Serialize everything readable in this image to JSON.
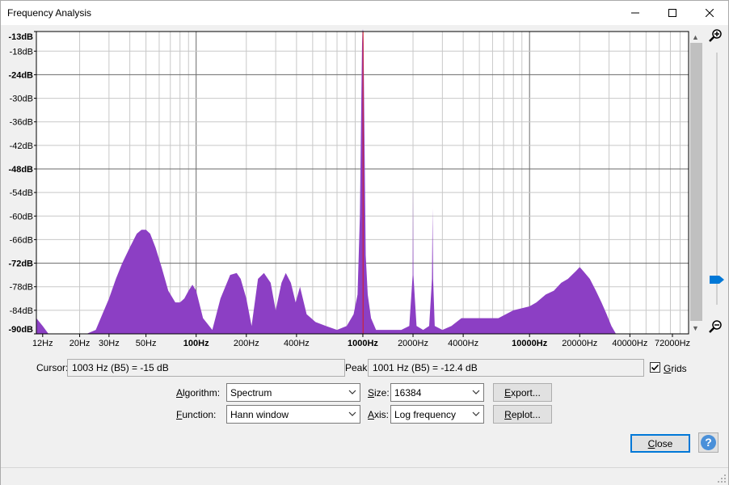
{
  "window": {
    "title": "Frequency Analysis",
    "minimize_icon": "minimize-icon",
    "maximize_icon": "maximize-icon",
    "close_icon": "close-icon"
  },
  "plot": {
    "y_labels": [
      {
        "text": "-13dB",
        "db": -13,
        "bold": true
      },
      {
        "text": "-18dB",
        "db": -18,
        "bold": false
      },
      {
        "text": "-24dB",
        "db": -24,
        "bold": true
      },
      {
        "text": "-30dB",
        "db": -30,
        "bold": false
      },
      {
        "text": "-36dB",
        "db": -36,
        "bold": false
      },
      {
        "text": "-42dB",
        "db": -42,
        "bold": false
      },
      {
        "text": "-48dB",
        "db": -48,
        "bold": true
      },
      {
        "text": "-54dB",
        "db": -54,
        "bold": false
      },
      {
        "text": "-60dB",
        "db": -60,
        "bold": false
      },
      {
        "text": "-66dB",
        "db": -66,
        "bold": false
      },
      {
        "text": "-72dB",
        "db": -72,
        "bold": true
      },
      {
        "text": "-78dB",
        "db": -78,
        "bold": false
      },
      {
        "text": "-84dB",
        "db": -84,
        "bold": false
      },
      {
        "text": "-90dB",
        "db": -90,
        "bold": true
      }
    ],
    "x_labels": [
      {
        "text": "12Hz",
        "hz": 12,
        "bold": false
      },
      {
        "text": "20Hz",
        "hz": 20,
        "bold": false
      },
      {
        "text": "30Hz",
        "hz": 30,
        "bold": false
      },
      {
        "text": "50Hz",
        "hz": 50,
        "bold": false
      },
      {
        "text": "100Hz",
        "hz": 100,
        "bold": true
      },
      {
        "text": "200Hz",
        "hz": 200,
        "bold": false
      },
      {
        "text": "400Hz",
        "hz": 400,
        "bold": false
      },
      {
        "text": "1000Hz",
        "hz": 1000,
        "bold": true
      },
      {
        "text": "2000Hz",
        "hz": 2000,
        "bold": false
      },
      {
        "text": "4000Hz",
        "hz": 4000,
        "bold": false
      },
      {
        "text": "10000Hz",
        "hz": 10000,
        "bold": true
      },
      {
        "text": "20000Hz",
        "hz": 20000,
        "bold": false
      },
      {
        "text": "40000Hz",
        "hz": 40000,
        "bold": false
      },
      {
        "text": "72000Hz",
        "hz": 72000,
        "bold": false
      }
    ],
    "cursor_hz": 1003,
    "zoom_in_icon": "zoom-in-icon",
    "zoom_out_icon": "zoom-out-icon",
    "zoom_level": 0.1
  },
  "chart_data": {
    "type": "area",
    "xscale": "log",
    "xlim": [
      11,
      90000
    ],
    "ylim": [
      -90,
      -13
    ],
    "grid": true,
    "color": "#8c3fc4",
    "cursor_color": "#d62020",
    "x": [
      11,
      12,
      13,
      15,
      18,
      20,
      22,
      25,
      28,
      30,
      33,
      36,
      40,
      44,
      47,
      50,
      53,
      57,
      62,
      68,
      75,
      80,
      85,
      90,
      95,
      100,
      110,
      125,
      140,
      160,
      175,
      185,
      200,
      215,
      235,
      255,
      280,
      300,
      325,
      345,
      370,
      395,
      420,
      460,
      520,
      600,
      700,
      800,
      880,
      930,
      960,
      980,
      990,
      995,
      1000,
      1005,
      1010,
      1020,
      1040,
      1070,
      1120,
      1200,
      1350,
      1500,
      1700,
      1900,
      1990,
      2000,
      2010,
      2100,
      2300,
      2500,
      2600,
      2620,
      2640,
      2700,
      3000,
      3400,
      3900,
      4500,
      5500,
      6500,
      8000,
      10000,
      11000,
      12500,
      14000,
      15500,
      17000,
      19000,
      20000,
      21000,
      23000,
      25000,
      27000,
      29000,
      31000,
      33000,
      90000
    ],
    "values": [
      -86,
      -88,
      -90,
      -90,
      -90,
      -90,
      -90,
      -89,
      -84,
      -81,
      -76,
      -72,
      -68,
      -64.5,
      -63.5,
      -63.5,
      -64.5,
      -68,
      -73,
      -79,
      -82,
      -82,
      -81,
      -79,
      -77.5,
      -79,
      -86,
      -89,
      -81,
      -75,
      -74.5,
      -76,
      -81,
      -88,
      -76,
      -74.5,
      -77,
      -84,
      -77,
      -74.5,
      -77,
      -82,
      -78,
      -85,
      -87,
      -88,
      -89,
      -88,
      -85,
      -80,
      -60,
      -30,
      -16,
      -13,
      -12.4,
      -13,
      -16,
      -35,
      -70,
      -80,
      -86,
      -89,
      -89,
      -89,
      -89,
      -88,
      -75,
      -53,
      -75,
      -88,
      -89,
      -88,
      -76,
      -58,
      -76,
      -88,
      -89,
      -88,
      -86,
      -86,
      -86,
      -86,
      -84,
      -83,
      -82,
      -80,
      -79,
      -77,
      -76,
      -74,
      -73,
      -74,
      -76,
      -79,
      -82,
      -85,
      -88,
      -90,
      -90
    ]
  },
  "controls": {
    "cursor_label": "Cursor:",
    "cursor_value": "1003 Hz (B5) = -15 dB",
    "peak_label": "Peak:",
    "peak_value": "1001 Hz (B5) = -12.4 dB",
    "grids_label": "Grids",
    "grids_checked": true,
    "algorithm_label": "Algorithm:",
    "algorithm_value": "Spectrum",
    "size_label": "Size:",
    "size_value": "16384",
    "function_label": "Function:",
    "function_value": "Hann window",
    "axis_label": "Axis:",
    "axis_value": "Log frequency",
    "export_label": "Export...",
    "replot_label": "Replot...",
    "close_label": "Close",
    "help_icon": "help-icon"
  }
}
